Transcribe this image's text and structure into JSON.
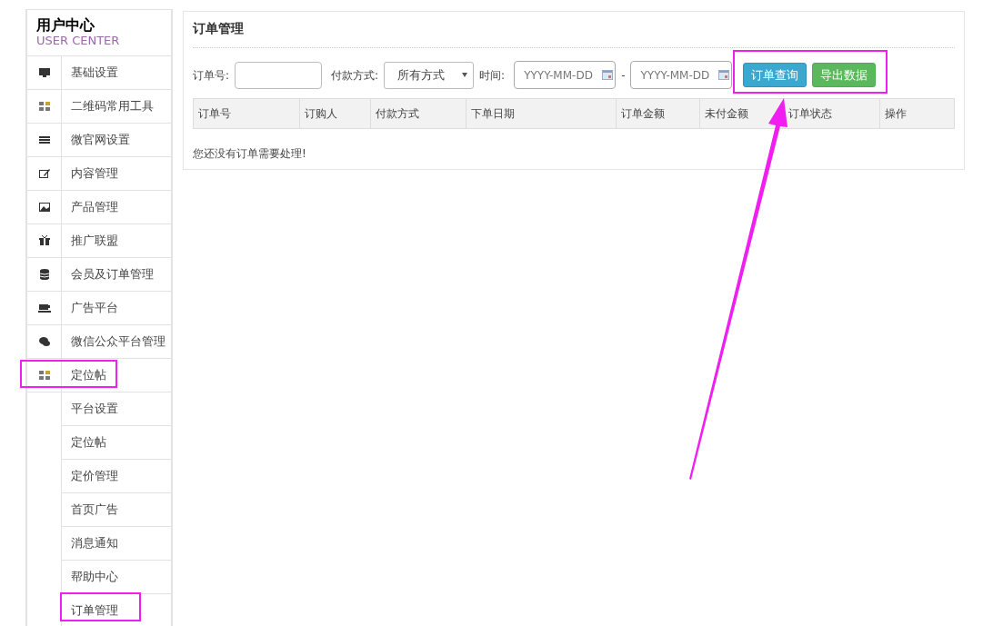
{
  "sidebar": {
    "title": "用户中心",
    "subtitle": "USER CENTER",
    "items": [
      {
        "label": "基础设置"
      },
      {
        "label": "二维码常用工具"
      },
      {
        "label": "微官网设置"
      },
      {
        "label": "内容管理"
      },
      {
        "label": "产品管理"
      },
      {
        "label": "推广联盟"
      },
      {
        "label": "会员及订单管理"
      },
      {
        "label": "广告平台"
      },
      {
        "label": "微信公众平台管理"
      },
      {
        "label": "定位帖",
        "children": [
          {
            "label": "平台设置"
          },
          {
            "label": "定位帖"
          },
          {
            "label": "定价管理"
          },
          {
            "label": "首页广告"
          },
          {
            "label": "消息通知"
          },
          {
            "label": "帮助中心"
          },
          {
            "label": "订单管理"
          }
        ]
      }
    ]
  },
  "main": {
    "title": "订单管理",
    "filters": {
      "order_no_label": "订单号:",
      "payment_label": "付款方式:",
      "payment_value": "所有方式",
      "time_label": "时间:",
      "date_from_placeholder": "YYYY-MM-DD",
      "date_separator": "-",
      "date_to_placeholder": "YYYY-MM-DD"
    },
    "buttons": [
      {
        "label": "订单查询",
        "kind": "info"
      },
      {
        "label": "导出数据",
        "kind": "success"
      }
    ],
    "table": {
      "columns": [
        "订单号",
        "订购人",
        "付款方式",
        "下单日期",
        "订单金额",
        "未付金额",
        "订单状态",
        "操作"
      ]
    },
    "empty_message": "您还没有订单需要处理!"
  }
}
